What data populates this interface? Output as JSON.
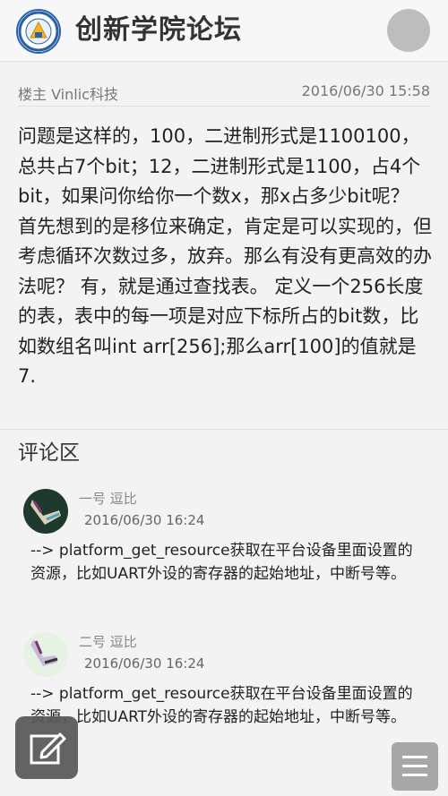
{
  "header": {
    "title": "创新学院论坛",
    "logo_icon": "college-seal-logo",
    "user_avatar_icon": "user-avatar-icon"
  },
  "post": {
    "author": "楼主 Vinlic科技",
    "time": "2016/06/30 15:58",
    "body": "问题是这样的，100，二进制形式是1100100，总共占7个bit；12，二进制形式是1100，占4个bit，如果问你给你一个数x，那x占多少bit呢？ 首先想到的是移位来确定，肯定是可以实现的，但考虑循环次数过多，放弃。那么有没有更高效的办法呢？ 有，就是通过查找表。 定义一个256长度的表，表中的每一项是对应下标所占的bit数，比如数组名叫int arr[256];那么arr[100]的值就是7."
  },
  "comments_section": {
    "title": "评论区",
    "comments": [
      {
        "name": "一号 逗比",
        "time": "2016/06/30 16:24",
        "text": "--> platform_get_resource获取在平台设备里面设置的资源，比如UART外设的寄存器的起始地址，中断号等。"
      },
      {
        "name": "二号 逗比",
        "time": "2016/06/30 16:24",
        "text": "--> platform_get_resource获取在平台设备里面设置的资源，比如UART外设的寄存器的起始地址，中断号等。"
      }
    ]
  },
  "floating_buttons": {
    "edit_icon": "edit-icon",
    "menu_icon": "hamburger-menu-icon"
  },
  "colors": {
    "header_bg": "#f7f7f7",
    "page_bg": "#f3f3f3",
    "fab_edit": "#575757",
    "fab_menu": "#9f9f9f"
  }
}
